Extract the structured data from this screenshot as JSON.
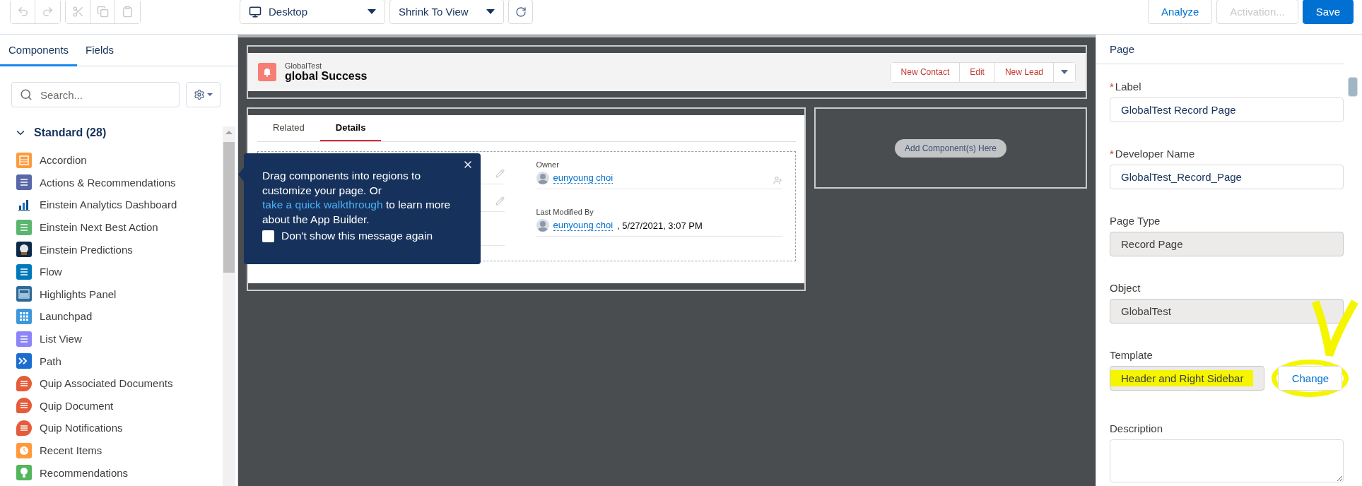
{
  "toolbar": {
    "history_buttons": [
      {
        "kind": "undo",
        "disabled": true
      },
      {
        "kind": "redo",
        "disabled": true
      }
    ],
    "edit_buttons": [
      {
        "kind": "cut",
        "disabled": true
      },
      {
        "kind": "copy",
        "disabled": true
      },
      {
        "kind": "paste",
        "disabled": true
      }
    ],
    "device": "Desktop",
    "zoom": "Shrink To View",
    "actions": [
      {
        "label": "Analyze",
        "kind": "neutral",
        "disabled": false
      },
      {
        "label": "Activation...",
        "kind": "neutral",
        "disabled": true
      },
      {
        "label": "Save",
        "kind": "brand",
        "disabled": false
      }
    ]
  },
  "left_panel": {
    "tabs": [
      {
        "label": "Components",
        "selected": true
      },
      {
        "label": "Fields",
        "selected": false
      }
    ],
    "search": {
      "placeholder": "Search..."
    },
    "section": {
      "title": "Standard (28)",
      "expanded": true,
      "items": [
        {
          "label": "Accordion",
          "color": "#ff9a3c"
        },
        {
          "label": "Actions & Recommendations",
          "color": "#5867a8"
        },
        {
          "label": "Einstein Analytics Dashboard",
          "color": "#ffffff"
        },
        {
          "label": "Einstein Next Best Action",
          "color": "#5ab56e"
        },
        {
          "label": "Einstein Predictions",
          "color": "#0b2a4a"
        },
        {
          "label": "Flow",
          "color": "#0079bc"
        },
        {
          "label": "Highlights Panel",
          "color": "#2f6a98"
        },
        {
          "label": "Launchpad",
          "color": "#3c97dd"
        },
        {
          "label": "List View",
          "color": "#8b85f9"
        },
        {
          "label": "Path",
          "color": "#1b6dd0"
        },
        {
          "label": "Quip Associated Documents",
          "color": "#e45d3b"
        },
        {
          "label": "Quip Document",
          "color": "#e45d3b"
        },
        {
          "label": "Quip Notifications",
          "color": "#e45d3b"
        },
        {
          "label": "Recent Items",
          "color": "#ff9a3c"
        },
        {
          "label": "Recommendations",
          "color": "#54b65c"
        }
      ]
    }
  },
  "canvas": {
    "header": {
      "object": "GlobalTest",
      "title": "global Success",
      "actions": [
        "New Contact",
        "Edit",
        "New Lead"
      ]
    },
    "tabs": [
      {
        "label": "Related",
        "selected": false
      },
      {
        "label": "Details",
        "selected": true
      }
    ],
    "fields": [
      {
        "label": "Owner",
        "value": "eunyoung choi"
      },
      {
        "label": "Last Modified By",
        "value": "eunyoung choi",
        "suffix": ", 5/27/2021, 3:07 PM"
      }
    ],
    "drop_zone": "Add Component(s) Here",
    "tooltip": {
      "before": "Drag components into regions to customize your page. Or ",
      "link": "take a quick walkthrough",
      "after": " to learn more about the App Builder.",
      "checkbox": {
        "label": "Don't show this message again",
        "checked": false
      }
    }
  },
  "right_panel": {
    "title": "Page",
    "fields": [
      {
        "kind": "input",
        "label": "Label",
        "required_mark": "*",
        "value": "GlobalTest Record Page"
      },
      {
        "kind": "input",
        "label": "Developer Name",
        "required_mark": "*",
        "value": "GlobalTest_Record_Page"
      },
      {
        "kind": "readonly",
        "label": "Page Type",
        "value": "Record Page"
      },
      {
        "kind": "readonly",
        "label": "Object",
        "value": "GlobalTest"
      },
      {
        "kind": "template",
        "label": "Template",
        "value": "Header and Right Sidebar",
        "button": "Change"
      },
      {
        "kind": "textarea",
        "label": "Description"
      }
    ]
  }
}
